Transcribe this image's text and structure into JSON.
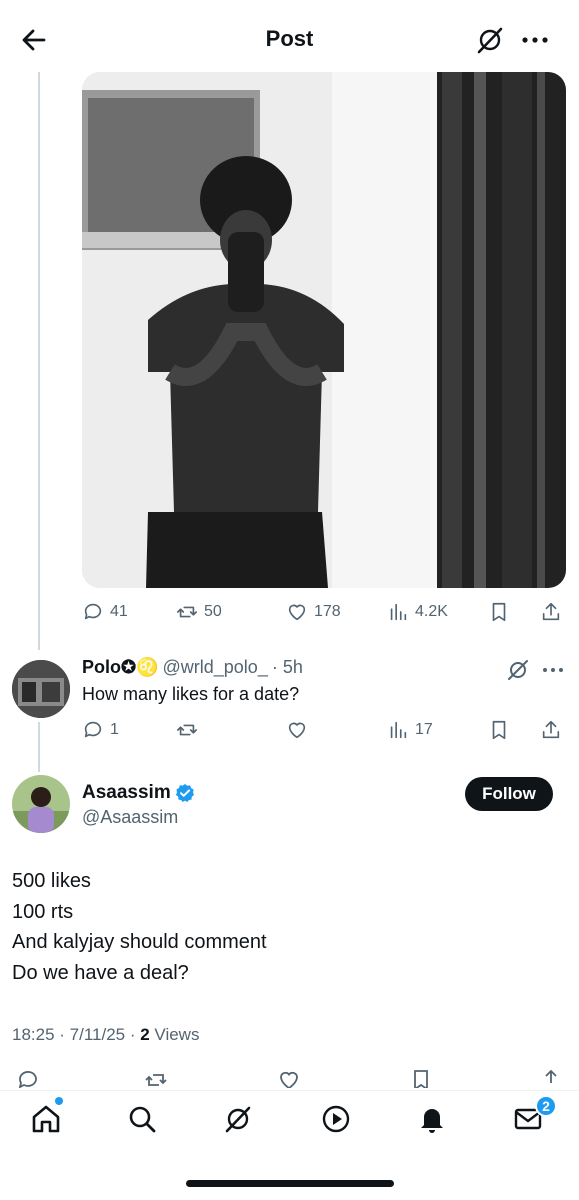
{
  "header": {
    "title": "Post"
  },
  "post_stats": {
    "replies": "41",
    "reposts": "50",
    "likes": "178",
    "views": "4.2K"
  },
  "reply": {
    "name": "Polo✪♌",
    "handle": "@wrld_polo_",
    "time": "· 5h",
    "text": "How many likes for a date?",
    "replies": "1",
    "views": "17"
  },
  "main_tweet": {
    "name": "Asaassim",
    "handle": "@Asaassim",
    "follow_label": "Follow",
    "lines": [
      "500 likes",
      "100 rts",
      "And kalyjay should comment",
      "Do we have a deal?"
    ],
    "timestamp": "18:25 · 7/11/25 · ",
    "views_count": "2",
    "views_label": " Views"
  },
  "nav": {
    "messages_badge": "2"
  },
  "colors": {
    "accent": "#1d9bf0",
    "text": "#0f1419",
    "muted": "#536471"
  }
}
